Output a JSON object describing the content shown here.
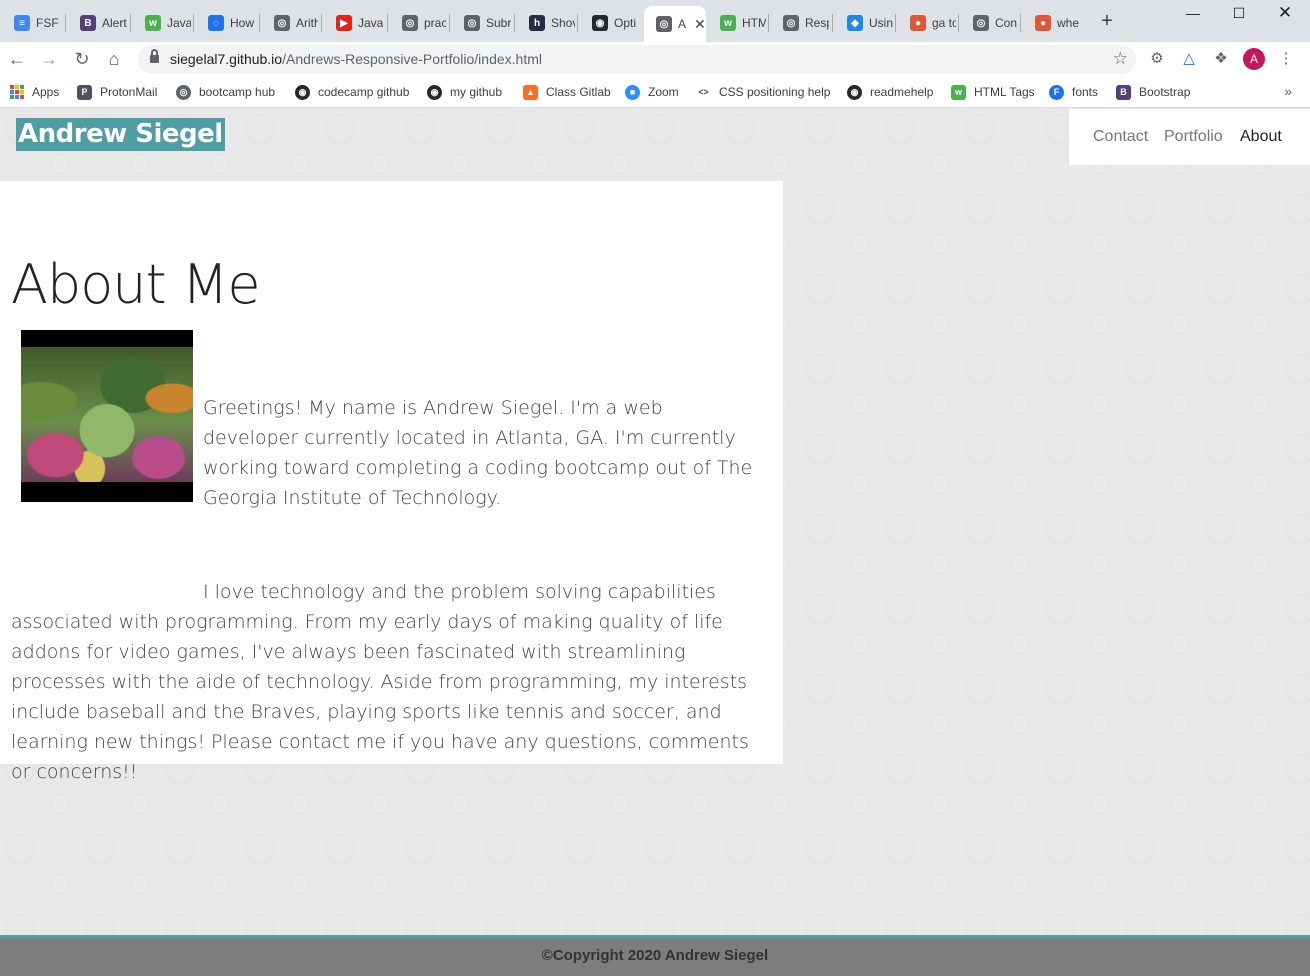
{
  "browser": {
    "tabs": [
      {
        "label": "FSF I",
        "icon": "docs-icon",
        "color": "#4285f4"
      },
      {
        "label": "Alert",
        "icon": "bootstrap-icon",
        "color": "#563d7c"
      },
      {
        "label": "Java",
        "icon": "w3schools-icon",
        "color": "#4caf50"
      },
      {
        "label": "How",
        "icon": "discuss-icon",
        "color": "#1a73e8"
      },
      {
        "label": "Arith",
        "icon": "globe-icon",
        "color": "#5f6368"
      },
      {
        "label": "Java",
        "icon": "youtube-icon",
        "color": "#e62117"
      },
      {
        "label": "prac",
        "icon": "globe-icon",
        "color": "#5f6368"
      },
      {
        "label": "Subr",
        "icon": "globe-icon",
        "color": "#5f6368"
      },
      {
        "label": "Shov",
        "icon": "hu-icon",
        "color": "#2a2a4a"
      },
      {
        "label": "Opti",
        "icon": "github-icon",
        "color": "#24292e"
      },
      {
        "label": "A",
        "icon": "globe-icon",
        "color": "#5f6368",
        "active": true
      },
      {
        "label": "HTM",
        "icon": "w3schools-icon",
        "color": "#4caf50"
      },
      {
        "label": "Resp",
        "icon": "globe-icon",
        "color": "#5f6368"
      },
      {
        "label": "Usin",
        "icon": "codepen-icon",
        "color": "#1e88e5"
      },
      {
        "label": "ga to",
        "icon": "duckduckgo-icon",
        "color": "#de5833"
      },
      {
        "label": "Con",
        "icon": "globe-icon",
        "color": "#5f6368"
      },
      {
        "label": "whe",
        "icon": "duckduckgo-icon",
        "color": "#de5833"
      }
    ],
    "url_host": "siegelal7.github.io",
    "url_path": "/Andrews-Responsive-Portfolio/index.html",
    "profile_initial": "A",
    "bookmarks": [
      {
        "label": "Apps",
        "icon": "apps-grid-icon"
      },
      {
        "label": "ProtonMail",
        "icon": "protonmail-icon",
        "color": "#505264"
      },
      {
        "label": "bootcamp hub",
        "icon": "globe-icon",
        "color": "#5f6368"
      },
      {
        "label": "codecamp github",
        "icon": "github-icon",
        "color": "#24292e"
      },
      {
        "label": "my github",
        "icon": "github-icon",
        "color": "#24292e"
      },
      {
        "label": "Class Gitlab",
        "icon": "gitlab-icon",
        "color": "#fc6d26"
      },
      {
        "label": "Zoom",
        "icon": "zoom-icon",
        "color": "#2d8cff"
      },
      {
        "label": "CSS positioning help",
        "icon": "code-icon",
        "color": "#5f6368"
      },
      {
        "label": "readmehelp",
        "icon": "github-icon",
        "color": "#24292e"
      },
      {
        "label": "HTML Tags",
        "icon": "w3schools-icon",
        "color": "#4caf50"
      },
      {
        "label": "fonts",
        "icon": "fonts-icon",
        "color": "#1a73e8"
      },
      {
        "label": "Bootstrap",
        "icon": "bootstrap-icon",
        "color": "#563d7c"
      }
    ]
  },
  "site": {
    "brand": "Andrew Siegel",
    "nav": {
      "contact": "Contact",
      "portfolio": "Portfolio",
      "about": "About"
    },
    "heading": "About Me",
    "paragraph1": "Greetings! My name is Andrew Siegel. I'm a web developer currently located in Atlanta, GA. I'm currently working toward completing a coding bootcamp out of The Georgia Institute of Technology.",
    "paragraph2": "I love technology and the problem solving capabilities associated with programming. From my early days of making quality of life addons for video games, I've always been fascinated with streamlining processes with the aide of technology. Aside from programming, my interests include baseball and the Braves, playing sports like tennis and soccer, and learning new things! Please contact me if you have any questions, comments or concerns!!",
    "footer": "©Copyright 2020 Andrew Siegel",
    "accent_color": "#4f9ea3",
    "footer_color": "#7d7d7d"
  }
}
